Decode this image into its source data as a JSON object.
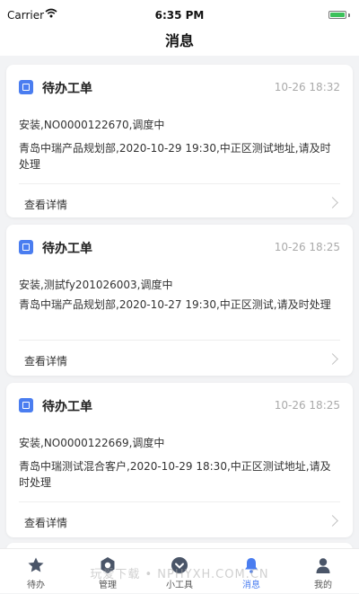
{
  "status": {
    "carrier": "Carrier",
    "time": "6:35 PM",
    "battery_level": 1.0
  },
  "nav": {
    "title": "消息"
  },
  "messages": [
    {
      "title": "待办工单",
      "time": "10-26 18:32",
      "line1": "安装,NO0000122670,调度中",
      "line2": "青岛中瑞产品规划部,2020-10-29 19:30,中正区测试地址,请及时处理",
      "detail": "查看详情"
    },
    {
      "title": "待办工单",
      "time": "10-26 18:25",
      "line1": "安装,测試fy201026003,调度中",
      "line2": "青岛中瑞产品规划部,2020-10-27 19:30,中正区测试,请及时处理",
      "detail": "查看详情"
    },
    {
      "title": "待办工单",
      "time": "10-26 18:25",
      "line1": "安装,NO0000122669,调度中",
      "line2": "青岛中瑞测试混合客户,2020-10-29 18:30,中正区测试地址,请及时处理",
      "detail": "查看详情"
    }
  ],
  "tabs": [
    {
      "label": "待办",
      "icon": "star-icon"
    },
    {
      "label": "管理",
      "icon": "settings-icon"
    },
    {
      "label": "小工具",
      "icon": "chevron-circle-icon"
    },
    {
      "label": "消息",
      "icon": "bell-icon",
      "active": true
    },
    {
      "label": "我的",
      "icon": "person-icon"
    }
  ],
  "watermark": "玩爱下载 • NPHYXH.COM.CN",
  "colors": {
    "accent": "#4a7df0",
    "background": "#f2f3f5",
    "time_gray": "#aaaaaa"
  }
}
